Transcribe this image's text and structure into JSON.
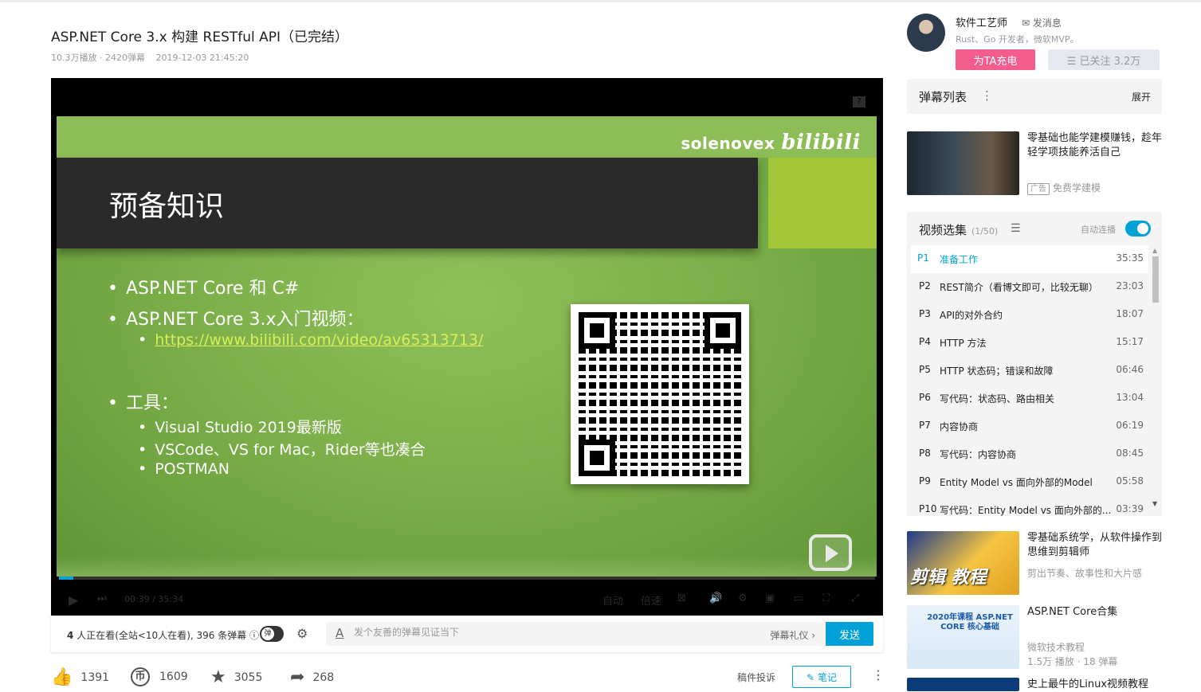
{
  "video": {
    "title": "ASP.NET Core 3.x 构建 RESTful API（已完结）",
    "plays": "10.3万播放 · 2420弹幕",
    "date": "2019-12-03 21:45:20"
  },
  "player": {
    "help": "?",
    "watermark_text": "solenovex",
    "watermark_logo": "bilibili",
    "slide_title": "预备知识",
    "bullet1": "ASP.NET Core 和 C#",
    "bullet2": "ASP.NET Core 3.x入门视频：",
    "bullet2_link": "https://www.bilibili.com/video/av65313713/",
    "bullet3": "工具：",
    "tool1": "Visual Studio 2019最新版",
    "tool2": "VSCode、VS for Mac，Rider等也凑合",
    "tool3": "POSTMAN",
    "current_time": "00:39",
    "duration": "35:34",
    "auto_label": "自动",
    "speed_label": "倍速",
    "progress_fraction": 0.018
  },
  "danmaku_bar": {
    "viewers_count": "4",
    "viewers_text": "人正在看(全站<10人在看), 396 条弹幕",
    "placeholder": "发个友善的弹幕见证当下",
    "etiquette": "弹幕礼仪 ›",
    "send": "发送"
  },
  "actions": {
    "like": "1391",
    "coin": "1609",
    "favorite": "3055",
    "share": "268",
    "report": "稿件投诉",
    "note": "笔记"
  },
  "uploader": {
    "name": "软件工艺师",
    "message": "发消息",
    "desc": "Rust、Go 开发者，微软MVP。",
    "charge": "为TA充电",
    "followed": "☰ 已关注 3.2万"
  },
  "danmaku_list": {
    "title": "弹幕列表",
    "expand": "展开"
  },
  "ad": {
    "title": "零基础也能学建模赚钱，趁年轻学项技能养活自己",
    "tag": "广告",
    "source": "免费学建模"
  },
  "episodes": {
    "title": "视频选集",
    "count": "(1/50)",
    "autoplay": "自动连播",
    "items": [
      {
        "p": "P1",
        "name": "准备工作",
        "dur": "35:35"
      },
      {
        "p": "P2",
        "name": "REST简介（看博文即可，比较无聊）",
        "dur": "23:03"
      },
      {
        "p": "P3",
        "name": "API的对外合约",
        "dur": "18:07"
      },
      {
        "p": "P4",
        "name": "HTTP 方法",
        "dur": "15:17"
      },
      {
        "p": "P5",
        "name": "HTTP 状态码；错误和故障",
        "dur": "06:46"
      },
      {
        "p": "P6",
        "name": "写代码：状态码、路由相关",
        "dur": "13:04"
      },
      {
        "p": "P7",
        "name": "内容协商",
        "dur": "06:19"
      },
      {
        "p": "P8",
        "name": "写代码：内容协商",
        "dur": "08:45"
      },
      {
        "p": "P9",
        "name": "Entity Model vs 面向外部的Model",
        "dur": "05:58"
      },
      {
        "p": "P10",
        "name": "写代码：Entity Model vs 面向外部的...",
        "dur": "03:39"
      }
    ]
  },
  "recommendations": [
    {
      "title": "零基础系统学，从软件操作到思维到剪辑师",
      "sub": "剪出节奏、故事性和大片感",
      "stats": "",
      "thumb_text": "剪辑 教程"
    },
    {
      "title": "ASP.NET Core合集",
      "sub": "微软技术教程",
      "stats": "1.5万 播放 · 18 弹幕",
      "thumb_text": "2020年课程 ASP.NET CORE 核心基础"
    },
    {
      "title": "史上最牛的Linux视频教程",
      "sub": "",
      "stats": "",
      "thumb_text": ""
    }
  ]
}
